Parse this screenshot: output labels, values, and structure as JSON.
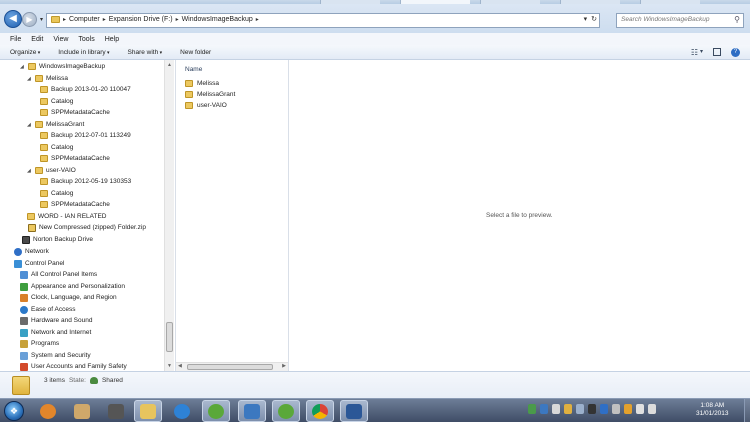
{
  "address": {
    "crumbs": [
      "Computer",
      "Expansion Drive (F:)",
      "WindowsImageBackup"
    ],
    "search_placeholder": "Search WindowsImageBackup"
  },
  "menu": [
    "File",
    "Edit",
    "View",
    "Tools",
    "Help"
  ],
  "commands": {
    "organize": "Organize",
    "include_in_library": "Include in library",
    "share_with": "Share with",
    "new_folder": "New folder"
  },
  "nav": [
    {
      "label": "WindowsImageBackup",
      "icon": "folder-icon"
    },
    {
      "label": "Melissa",
      "icon": "folder-icon"
    },
    {
      "label": "Backup 2013-01-20 110047",
      "icon": "folder-icon"
    },
    {
      "label": "Catalog",
      "icon": "folder-icon"
    },
    {
      "label": "SPPMetadataCache",
      "icon": "folder-icon"
    },
    {
      "label": "MelissaGrant",
      "icon": "folder-icon"
    },
    {
      "label": "Backup 2012-07-01 113249",
      "icon": "folder-icon"
    },
    {
      "label": "Catalog",
      "icon": "folder-icon"
    },
    {
      "label": "SPPMetadataCache",
      "icon": "folder-icon"
    },
    {
      "label": "user-VAIO",
      "icon": "folder-icon"
    },
    {
      "label": "Backup 2012-05-19 130353",
      "icon": "folder-icon"
    },
    {
      "label": "Catalog",
      "icon": "folder-icon"
    },
    {
      "label": "SPPMetadataCache",
      "icon": "folder-icon"
    },
    {
      "label": "WORD - IAN RELATED",
      "icon": "folder-icon"
    },
    {
      "label": "New Compressed (zipped) Folder.zip",
      "icon": "zip-icon"
    },
    {
      "label": "Norton Backup Drive",
      "icon": "norton-drive-icon"
    },
    {
      "label": "Network",
      "icon": "network-icon"
    },
    {
      "label": "Control Panel",
      "icon": "control-panel-icon"
    },
    {
      "label": "All Control Panel Items",
      "icon": "control-panel-items-icon"
    },
    {
      "label": "Appearance and Personalization",
      "icon": "appearance-icon"
    },
    {
      "label": "Clock, Language, and Region",
      "icon": "clock-region-icon"
    },
    {
      "label": "Ease of Access",
      "icon": "ease-of-access-icon"
    },
    {
      "label": "Hardware and Sound",
      "icon": "hardware-sound-icon"
    },
    {
      "label": "Network and Internet",
      "icon": "network-internet-icon"
    },
    {
      "label": "Programs",
      "icon": "programs-icon"
    },
    {
      "label": "System and Security",
      "icon": "system-security-icon"
    },
    {
      "label": "User Accounts and Family Safety",
      "icon": "user-accounts-icon"
    }
  ],
  "file_list": {
    "column_name": "Name",
    "items": [
      "Melissa",
      "MelissaGrant",
      "user-VAIO"
    ]
  },
  "preview": {
    "message": "Select a file to preview."
  },
  "details": {
    "count": "3 items",
    "state_label": "State:",
    "state_value": "Shared"
  },
  "taskbar": {
    "time": "1:08 AM",
    "date": "31/01/2013"
  },
  "colors": {
    "taskbar": "#4a5a75",
    "folder": "#ecc860",
    "accent": "#2c6cc3"
  }
}
